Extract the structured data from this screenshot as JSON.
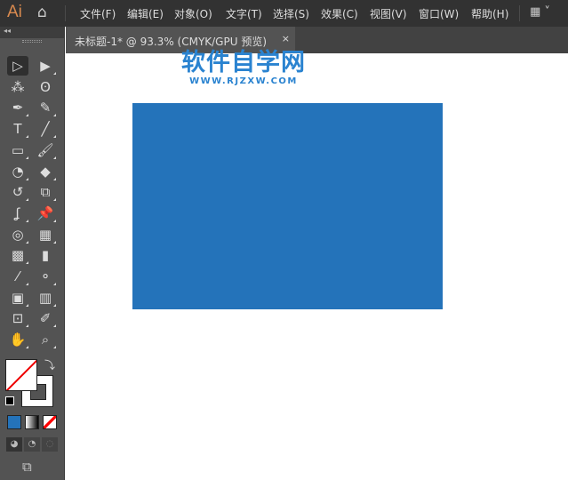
{
  "app": {
    "logo": "Ai"
  },
  "menu": [
    "文件(F)",
    "编辑(E)",
    "对象(O)",
    "文字(T)",
    "选择(S)",
    "效果(C)",
    "视图(V)",
    "窗口(W)",
    "帮助(H)"
  ],
  "tab": {
    "title": "未标题-1* @ 93.3% (CMYK/GPU 预览)",
    "close": "×"
  },
  "toolbar": {
    "collapse": "◂◂"
  },
  "tools": [
    [
      "selection-tool",
      "▷"
    ],
    [
      "direct-selection-tool",
      "▶"
    ],
    [
      "magic-wand-tool",
      "⁂"
    ],
    [
      "lasso-tool",
      "ʘ"
    ],
    [
      "pen-tool",
      "✒"
    ],
    [
      "curvature-tool",
      "✎"
    ],
    [
      "type-tool",
      "T"
    ],
    [
      "line-tool",
      "╱"
    ],
    [
      "rectangle-tool",
      "▭"
    ],
    [
      "paintbrush-tool",
      "🖌"
    ],
    [
      "shaper-tool",
      "◔"
    ],
    [
      "eraser-tool",
      "◆"
    ],
    [
      "rotate-tool",
      "↺"
    ],
    [
      "scale-tool",
      "⧉"
    ],
    [
      "puppet-warp-tool",
      "ʆ"
    ],
    [
      "pin-tool",
      "📌"
    ],
    [
      "shape-builder-tool",
      "◎"
    ],
    [
      "perspective-grid-tool",
      "▦"
    ],
    [
      "mesh-tool",
      "▩"
    ],
    [
      "gradient-tool",
      "▮"
    ],
    [
      "eyedropper-tool",
      "⁄"
    ],
    [
      "blend-tool",
      "⚬"
    ],
    [
      "symbol-sprayer-tool",
      "▣"
    ],
    [
      "column-graph-tool",
      "▥"
    ],
    [
      "artboard-tool",
      "⊡"
    ],
    [
      "slice-tool",
      "✐"
    ],
    [
      "hand-tool",
      "✋"
    ],
    [
      "zoom-tool",
      "⌕"
    ]
  ],
  "colors": {
    "rectangle": "#2473ba",
    "color_mode": "#2473ba",
    "stroke_none": "#ff0000"
  },
  "watermark": {
    "title": "软件自学网",
    "url": "WWW.RJZXW.COM"
  }
}
